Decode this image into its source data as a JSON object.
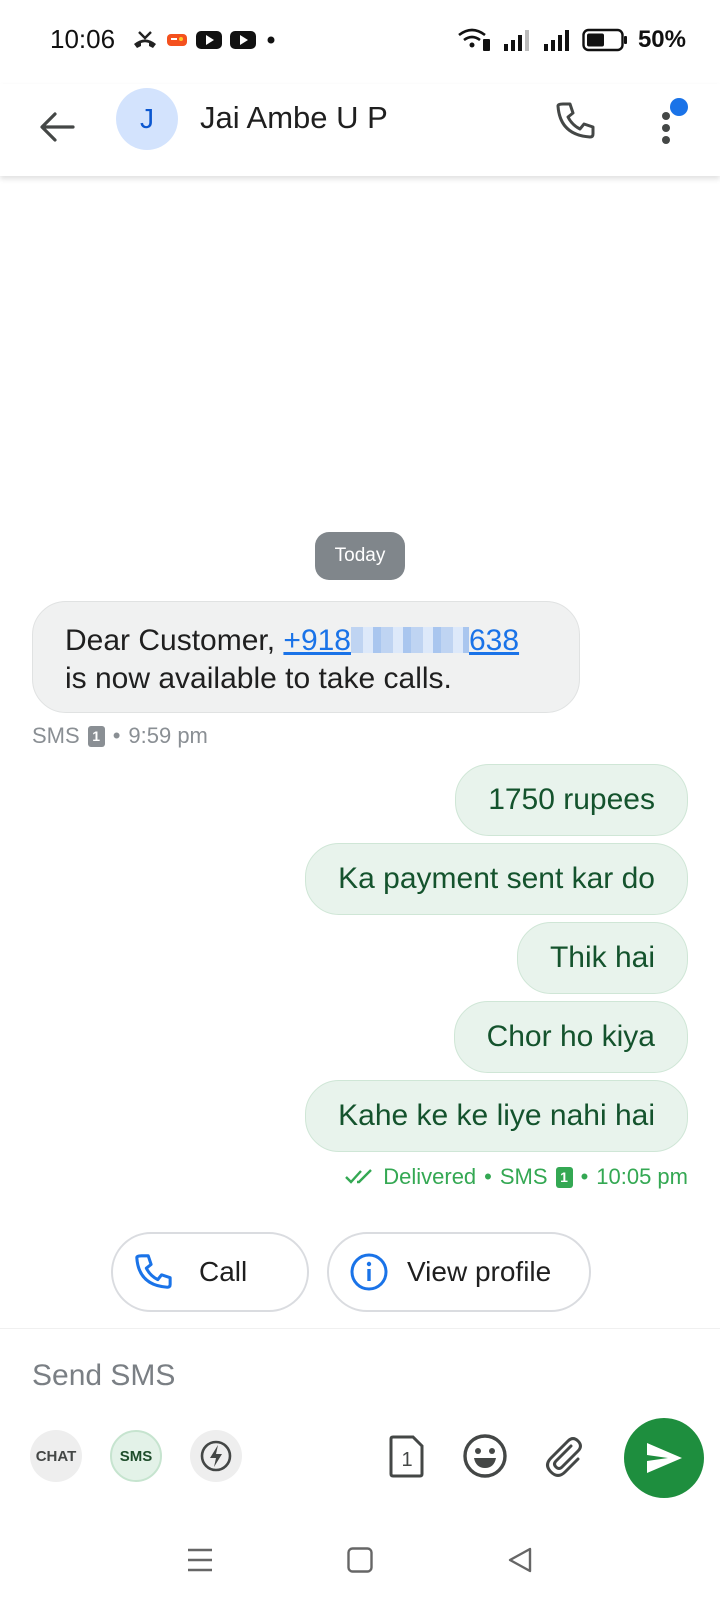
{
  "status_bar": {
    "time": "10:06",
    "battery": "50%",
    "icons": [
      "missed-call-icon",
      "game-icon",
      "youtube-icon",
      "youtube-icon",
      "dot-icon",
      "wifi-call-icon",
      "signal-icon",
      "signal-icon",
      "battery-icon"
    ]
  },
  "header": {
    "avatar_letter": "J",
    "contact_name": "Jai Ambe U P",
    "avatar_color": "#d3e3fd"
  },
  "conversation": {
    "date_chip": "Today",
    "incoming": {
      "text_before": "Dear Customer, ",
      "phone_start": "+918",
      "phone_end": "638",
      "text_after": "is now available to take calls.",
      "meta_channel": "SMS",
      "meta_sim": "1",
      "meta_time": "9:59 pm"
    },
    "outgoing": [
      "1750 rupees",
      "Ka payment sent kar do",
      "Thik hai",
      "Chor ho kiya",
      "Kahe ke ke liye nahi hai"
    ],
    "outgoing_meta": {
      "status": "Delivered",
      "channel": "SMS",
      "sim": "1",
      "time": "10:05 pm"
    }
  },
  "suggestions": {
    "call_label": "Call",
    "view_profile_label": "View profile"
  },
  "compose": {
    "placeholder": "Send SMS",
    "mode_chat": "CHAT",
    "mode_sms": "SMS",
    "sim_number": "1"
  },
  "colors": {
    "accent_blue": "#1a73e8",
    "send_green": "#1e8e3e",
    "outgoing_bubble": "#e8f3ec",
    "incoming_bubble": "#f0f1f1"
  }
}
